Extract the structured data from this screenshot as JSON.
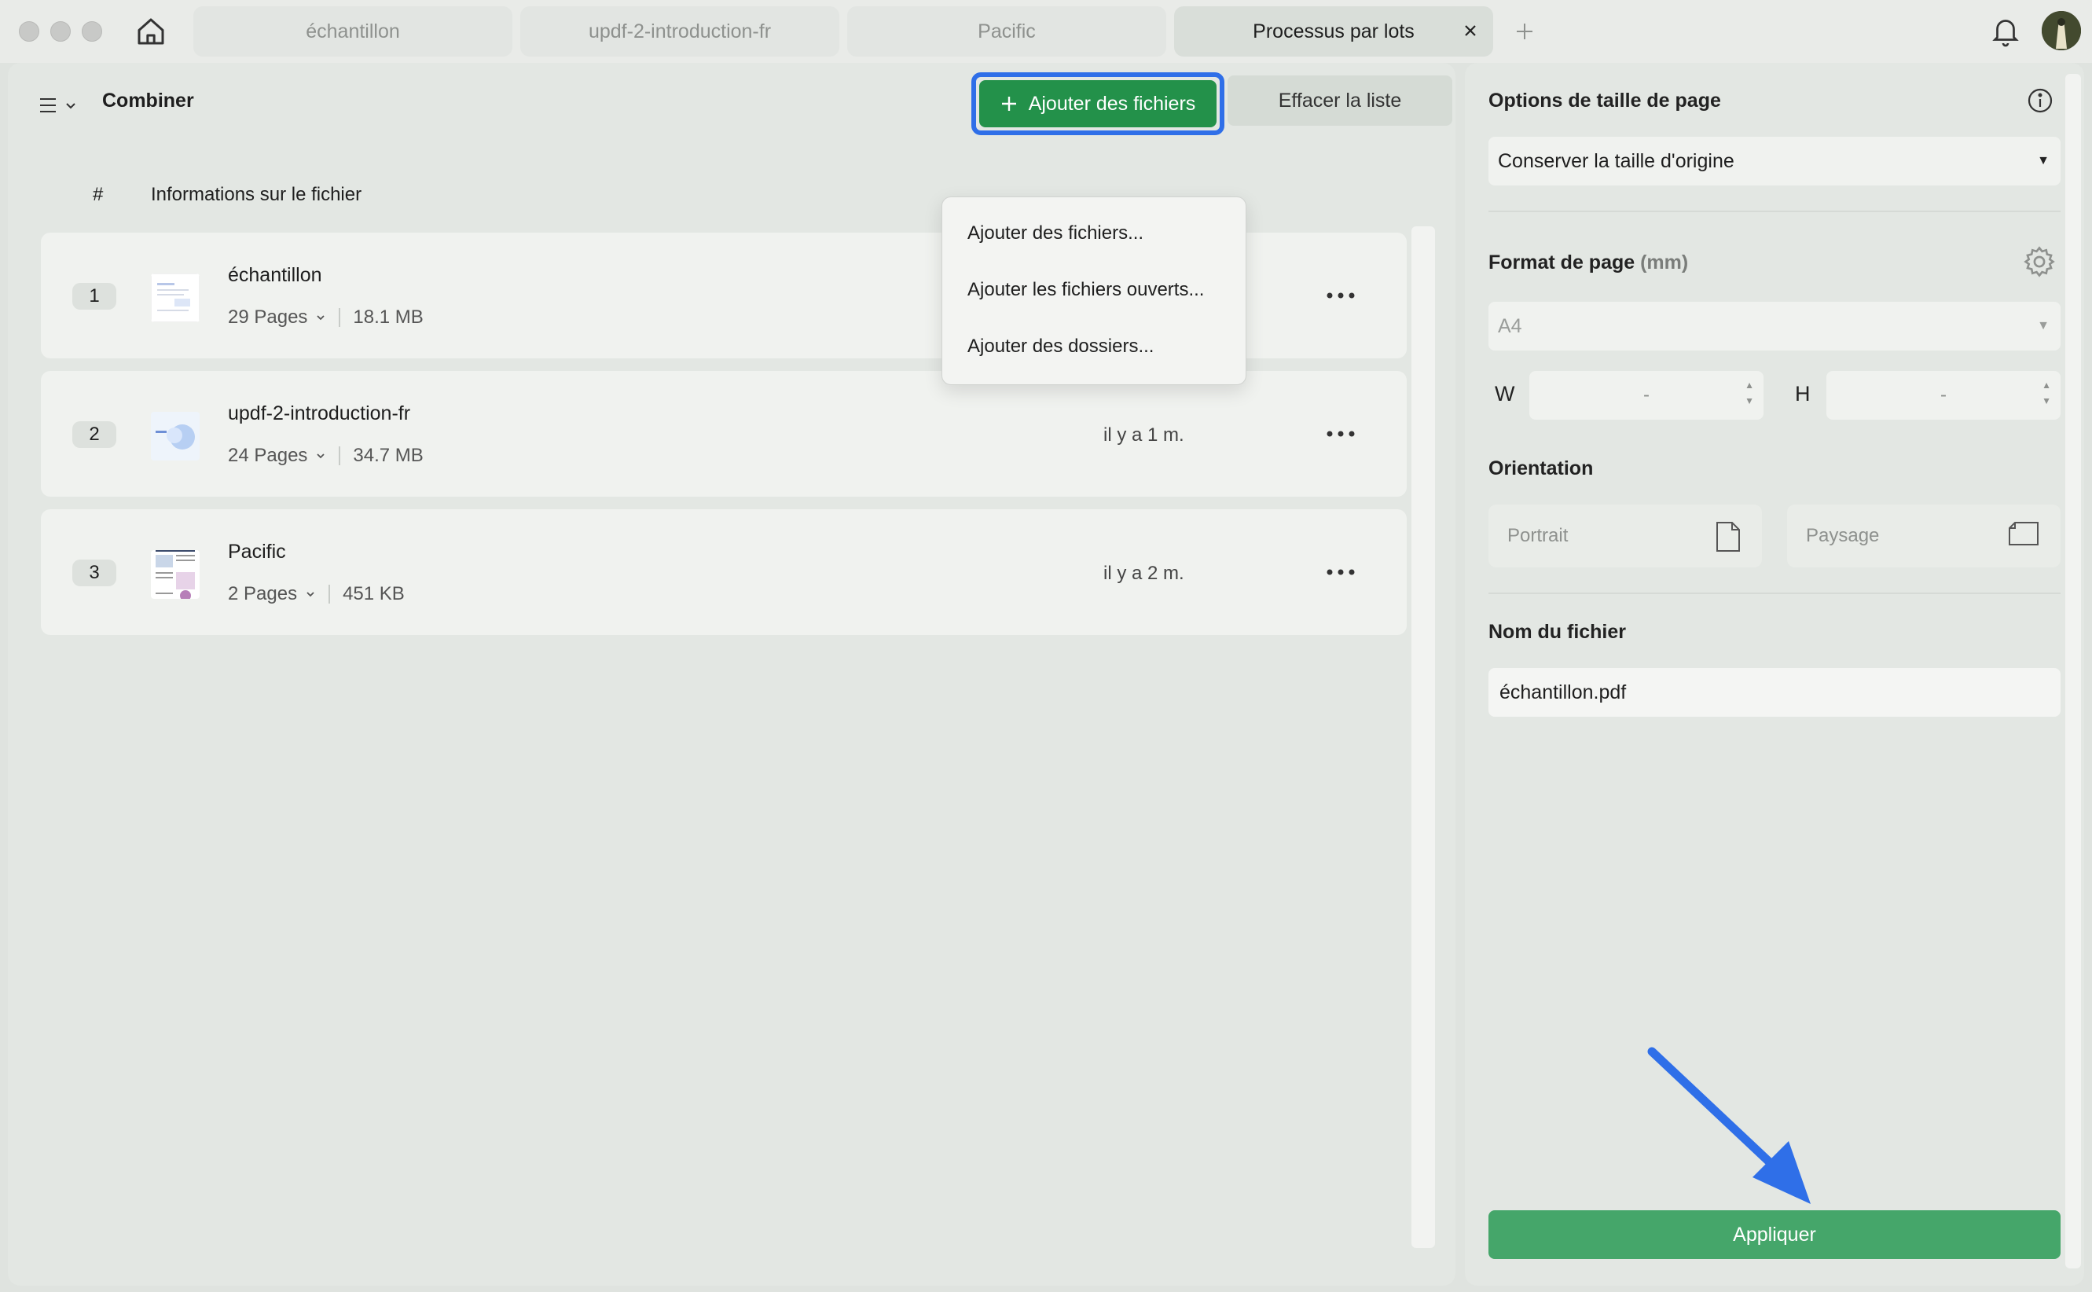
{
  "window": {
    "tabs": [
      {
        "label": "échantillon",
        "active": false
      },
      {
        "label": "updf-2-introduction-fr",
        "active": false
      },
      {
        "label": "Pacific",
        "active": false
      },
      {
        "label": "Processus par lots",
        "active": true
      }
    ]
  },
  "toolbar": {
    "title": "Combiner",
    "add_button": "Ajouter des fichiers",
    "clear_button": "Effacer la liste"
  },
  "dropdown": {
    "items": [
      "Ajouter des fichiers...",
      "Ajouter les fichiers ouverts...",
      "Ajouter des dossiers..."
    ]
  },
  "table": {
    "headers": {
      "index": "#",
      "info": "Informations sur le fichier"
    },
    "rows": [
      {
        "index": "1",
        "name": "échantillon",
        "pages": "29 Pages",
        "size": "18.1 MB",
        "time": ""
      },
      {
        "index": "2",
        "name": "updf-2-introduction-fr",
        "pages": "24 Pages",
        "size": "34.7 MB",
        "time": "il y a 1 m."
      },
      {
        "index": "3",
        "name": "Pacific",
        "pages": "2 Pages",
        "size": "451 KB",
        "time": "il y a 2 m."
      }
    ]
  },
  "settings": {
    "page_size_label": "Options de taille de page",
    "page_size_value": "Conserver la taille d'origine",
    "format_label": "Format de page",
    "format_unit": "(mm)",
    "format_value": "A4",
    "width_label": "W",
    "width_value": "-",
    "height_label": "H",
    "height_value": "-",
    "orientation_label": "Orientation",
    "portrait": "Portrait",
    "landscape": "Paysage",
    "filename_label": "Nom du fichier",
    "filename_value": "échantillon.pdf",
    "apply_button": "Appliquer"
  },
  "colors": {
    "accent_green": "#23914a",
    "apply_green": "#45a66a",
    "highlight_blue": "#2f6fe8"
  }
}
